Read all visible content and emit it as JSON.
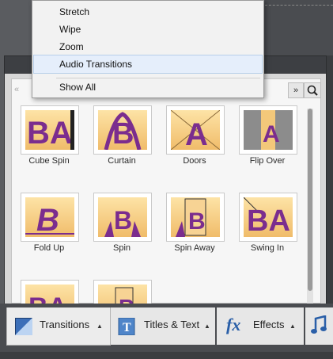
{
  "menu": {
    "items": [
      {
        "label": "Stretch"
      },
      {
        "label": "Wipe"
      },
      {
        "label": "Zoom"
      },
      {
        "label": "Audio Transitions"
      }
    ],
    "show_all": "Show All"
  },
  "tiles": [
    {
      "label": "Cube Spin",
      "art": "BA"
    },
    {
      "label": "Curtain",
      "art": "B"
    },
    {
      "label": "Doors",
      "art": "A"
    },
    {
      "label": "Flip Over",
      "art": "A"
    },
    {
      "label": "Fold Up",
      "art": "B"
    },
    {
      "label": "Spin",
      "art": "B"
    },
    {
      "label": "Spin Away",
      "art": "B"
    },
    {
      "label": "Swing In",
      "art": "BA"
    },
    {
      "label": "",
      "art": "BA"
    },
    {
      "label": "",
      "art": "B"
    }
  ],
  "tabs": {
    "transitions": "Transitions",
    "titles": "Titles & Text",
    "effects": "Effects",
    "effects_icon": "fx"
  },
  "colors": {
    "accent": "#7b2d8e",
    "thumb_top": "#fde3a6",
    "thumb_bottom": "#f0bc6a"
  },
  "icons": {
    "nav_left": "«",
    "nav_right": "»"
  }
}
